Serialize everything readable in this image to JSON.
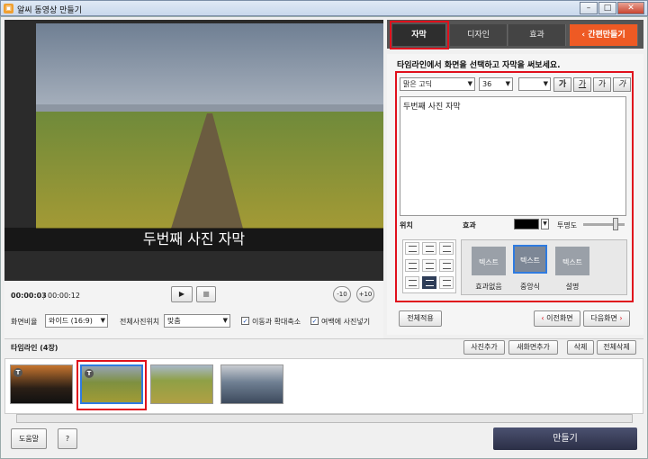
{
  "window": {
    "title": "알씨 동영상 만들기",
    "minimize": "–",
    "maximize": "□",
    "close": "✕"
  },
  "preview": {
    "subtitle": "두번째 사진 자막",
    "current_time": "00:00:03",
    "total_time": "00:00:12"
  },
  "controls": {
    "aspect_label": "화면비율",
    "aspect_value": "와이드 (16:9)",
    "position_label": "전체사진위치",
    "position_value": "맞춤",
    "zoom_label": "이동과 확대축소",
    "zoom_checked": true,
    "fill_label": "여백에 사진넣기",
    "fill_checked": true,
    "rewind_label": "-10",
    "forward_label": "+10"
  },
  "tabs": [
    {
      "label": "자막",
      "active": true
    },
    {
      "label": "디자인",
      "active": false
    },
    {
      "label": "효과",
      "active": false
    }
  ],
  "quick_button": "간편만들기",
  "subtitle_panel": {
    "instruction": "타임라인에서 화면을 선택하고 자막을 써보세요.",
    "font": "맑은 고딕",
    "size": "36",
    "format_buttons": [
      "가",
      "가",
      "가",
      "가"
    ],
    "text": "두번째 사진 자막",
    "position_label": "위치",
    "effect_label": "효과",
    "opacity_label": "투명도",
    "opacity": 0.82,
    "font_color": "#000000",
    "effects": [
      {
        "thumb": "텍스트",
        "label": "효과없음",
        "selected": false
      },
      {
        "thumb": "텍스트",
        "label": "중앙식",
        "selected": true
      },
      {
        "thumb": "텍스트",
        "label": "설명",
        "selected": false
      }
    ],
    "apply_all": "전체적용",
    "prev": "이전화면",
    "next": "다음화면"
  },
  "timeline": {
    "title": "타임라인 (4장)",
    "add_photo": "사진추가",
    "new_screen": "새화면추가",
    "delete": "삭제",
    "delete_all": "전체삭제"
  },
  "footer": {
    "help": "도움말",
    "question": "?",
    "make": "만들기"
  },
  "colors": {
    "accent_orange": "#ee5a24",
    "highlight_red": "#e0101c",
    "selection_blue": "#2f7be0"
  }
}
